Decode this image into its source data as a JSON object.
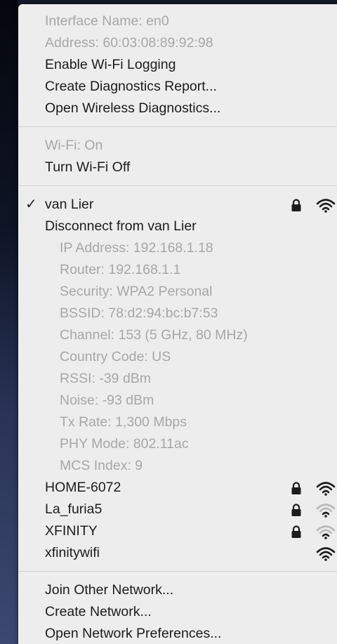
{
  "menu": {
    "section1": [
      {
        "label": "Interface Name: en0",
        "enabled": false
      },
      {
        "label": "Address: 60:03:08:89:92:98",
        "enabled": false
      },
      {
        "label": "Enable Wi-Fi Logging",
        "enabled": true
      },
      {
        "label": "Create Diagnostics Report...",
        "enabled": true
      },
      {
        "label": "Open Wireless Diagnostics...",
        "enabled": true
      }
    ],
    "section2": [
      {
        "label": "Wi-Fi: On",
        "enabled": false
      },
      {
        "label": "Turn Wi-Fi Off",
        "enabled": true
      }
    ],
    "current_network": {
      "check": "✓",
      "name": "van Lier",
      "icons": [
        "lock-icon",
        "wifi-signal-icon"
      ],
      "signal_bars": 3,
      "disconnect_label": "Disconnect from van Lier",
      "details": [
        "IP Address: 192.168.1.18",
        "Router: 192.168.1.1",
        "Security: WPA2 Personal",
        "BSSID: 78:d2:94:bc:b7:53",
        "Channel: 153 (5 GHz, 80 MHz)",
        "Country Code: US",
        "RSSI: -39 dBm",
        "Noise: -93 dBm",
        "Tx Rate: 1,300 Mbps",
        "PHY Mode: 802.11ac",
        "MCS Index: 9"
      ]
    },
    "networks": [
      {
        "name": "HOME-6072",
        "locked": true,
        "signal_bars": 3
      },
      {
        "name": "La_furia5",
        "locked": true,
        "signal_bars": 1
      },
      {
        "name": "XFINITY",
        "locked": true,
        "signal_bars": 1
      },
      {
        "name": "xfinitywifi",
        "locked": false,
        "signal_bars": 3
      }
    ],
    "section_footer": [
      {
        "label": "Join Other Network...",
        "enabled": true
      },
      {
        "label": "Create Network...",
        "enabled": true
      },
      {
        "label": "Open Network Preferences...",
        "enabled": true
      }
    ]
  },
  "colors": {
    "menu_bg": "#ededed",
    "text": "#1c1c1c",
    "disabled_text": "#a7a7a7",
    "separator": "#d2d2d2",
    "signal_dim": "#b8b8b8"
  }
}
